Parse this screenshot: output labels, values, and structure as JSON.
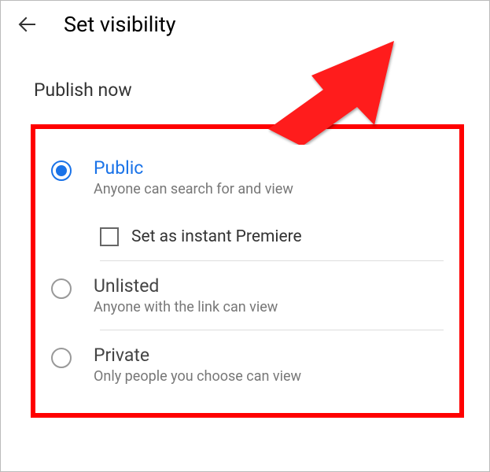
{
  "header": {
    "title": "Set visibility"
  },
  "section_label": "Publish now",
  "options": [
    {
      "title": "Public",
      "desc": "Anyone can search for and view",
      "selected": true
    },
    {
      "title": "Unlisted",
      "desc": "Anyone with the link can view",
      "selected": false
    },
    {
      "title": "Private",
      "desc": "Only people you choose can view",
      "selected": false
    }
  ],
  "premiere": {
    "label": "Set as instant Premiere",
    "checked": false
  },
  "annotation": {
    "highlight_color": "#ff0000"
  }
}
